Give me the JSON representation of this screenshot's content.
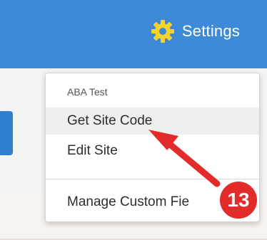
{
  "header": {
    "settings_label": "Settings",
    "settings_icon": "gear-icon"
  },
  "dropdown": {
    "section_title": "ABA Test",
    "items": [
      {
        "label": "Get Site Code",
        "active": true
      },
      {
        "label": "Edit Site",
        "active": false
      },
      {
        "label": "Manage Custom Fie",
        "active": false
      }
    ]
  },
  "annotation": {
    "step_number": "13"
  },
  "colors": {
    "header_bg": "#3f8ad8",
    "accent_red": "#e32b29",
    "hover_bg": "#efefef"
  }
}
